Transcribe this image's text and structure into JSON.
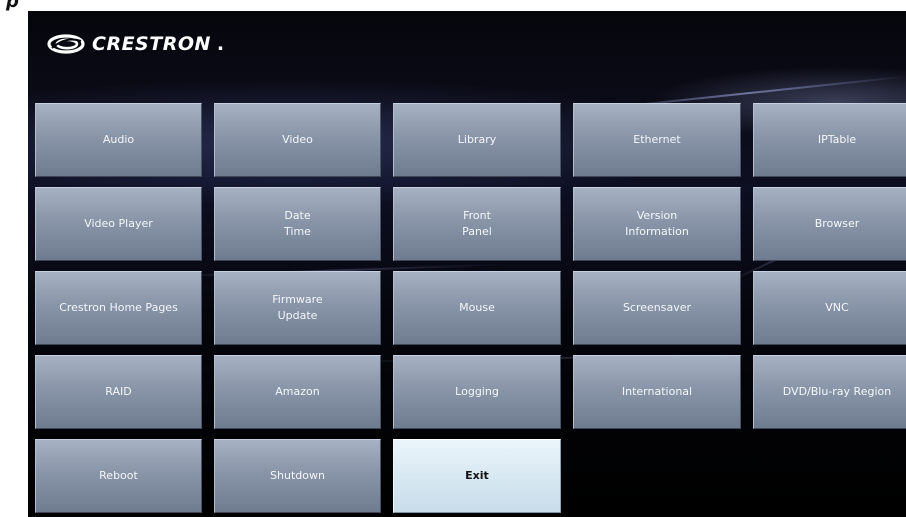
{
  "brand": {
    "logo_text": "CRESTRON",
    "logo_dot": ".",
    "logo_icon": "crestron-swirl-icon"
  },
  "top_glyph": "p",
  "menu": {
    "rows": [
      [
        {
          "label": "Audio"
        },
        {
          "label": "Video"
        },
        {
          "label": "Library"
        },
        {
          "label": "Ethernet"
        },
        {
          "label": "IPTable"
        }
      ],
      [
        {
          "label": "Video Player"
        },
        {
          "label": "Date\nTime"
        },
        {
          "label": "Front\nPanel"
        },
        {
          "label": "Version\nInformation"
        },
        {
          "label": "Browser"
        }
      ],
      [
        {
          "label": "Crestron Home Pages"
        },
        {
          "label": "Firmware\nUpdate"
        },
        {
          "label": "Mouse"
        },
        {
          "label": "Screensaver"
        },
        {
          "label": "VNC"
        }
      ],
      [
        {
          "label": "RAID"
        },
        {
          "label": "Amazon"
        },
        {
          "label": "Logging"
        },
        {
          "label": "International"
        },
        {
          "label": "DVD/Blu-ray Region"
        }
      ],
      [
        {
          "label": "Reboot"
        },
        {
          "label": "Shutdown"
        },
        {
          "label": "Exit"
        }
      ]
    ]
  },
  "colors": {
    "tile": "#8995a8",
    "exit_tile": "#d6e7f1",
    "background": "#000000"
  }
}
